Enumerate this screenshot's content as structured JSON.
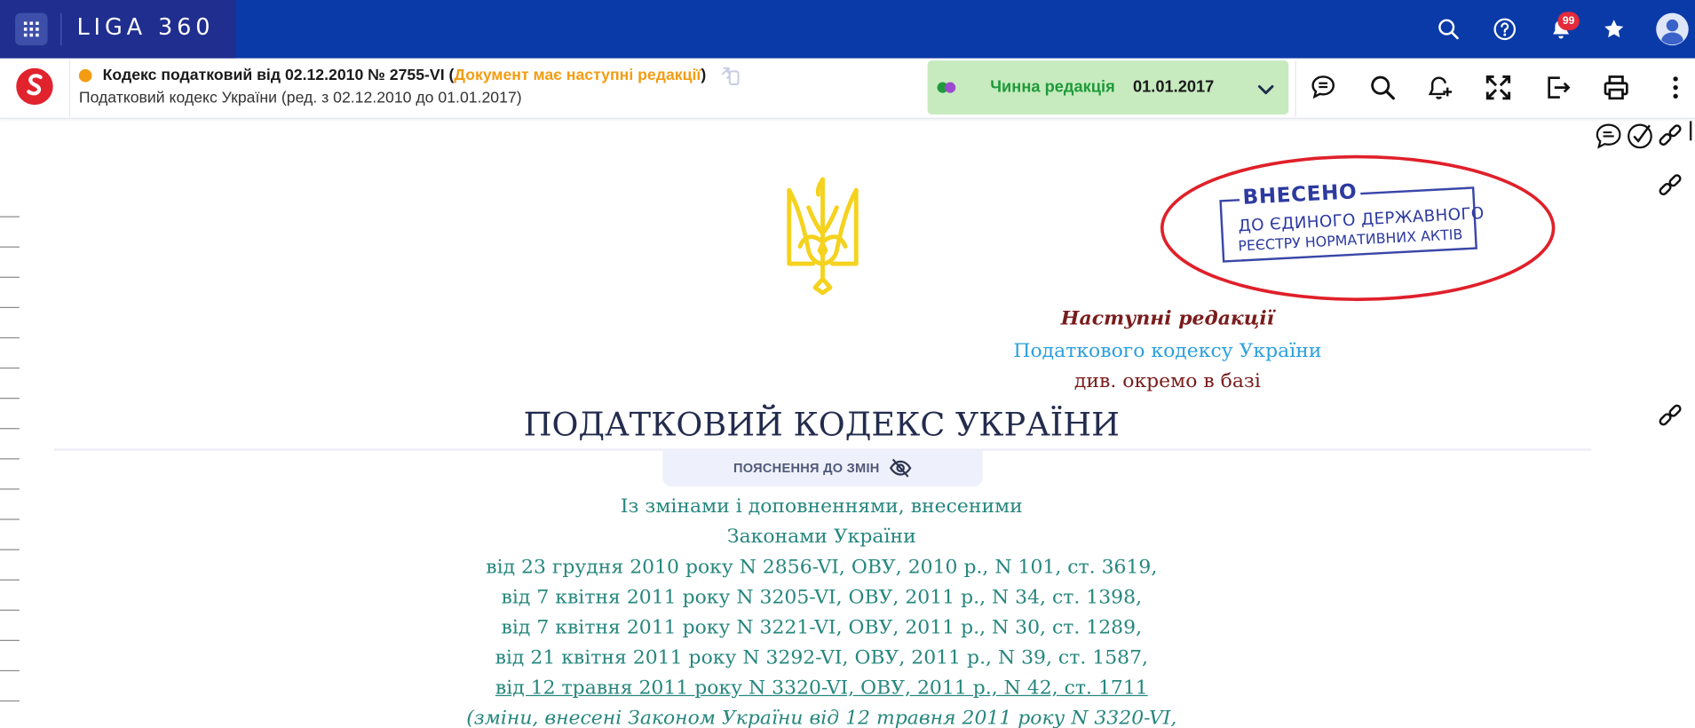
{
  "app": {
    "brand": "LIGA 360",
    "notifications_count": "99"
  },
  "topbar_icons": [
    "grid-apps-icon",
    "search-icon",
    "help-icon",
    "bell-icon",
    "star-icon",
    "user-avatar-icon"
  ],
  "document": {
    "title_prefix": "Кодекс податковий від 02.12.2010 № 2755-VI (",
    "title_warning": "Документ має наступні редакції",
    "title_suffix": ")",
    "subtitle": "Податковий кодекс України (ред. з 02.12.2010 до 01.01.2017)",
    "status_color": "#f39c12"
  },
  "edition": {
    "label": "Чинна редакція",
    "date": "01.01.2017"
  },
  "toolbar_icons": [
    "comments-icon",
    "search-in-doc-icon",
    "add-to-control-icon",
    "fullscreen-icon",
    "export-icon",
    "print-icon",
    "more-icon"
  ],
  "stamp": {
    "title": "ВНЕСЕНО",
    "line1": "ДО ЄДИНОГО ДЕРЖАВНОГО",
    "line2": "РЕЄСТРУ НОРМАТИВНИХ АКТІВ"
  },
  "next_editions": {
    "line1": "Наступні редакції",
    "line2": "Податкового кодексу України",
    "line3": "див. окремо в базі"
  },
  "main_title": "ПОДАТКОВИЙ КОДЕКС УКРАЇНИ",
  "explanation_button": "ПОЯСНЕННЯ ДО ЗМІН",
  "amendments": [
    "Із змінами і доповненнями, внесеними",
    "Законами  України",
    "від 23 грудня 2010 року N 2856-VI, ОВУ, 2010 р., N 101, ст. 3619,",
    "від 7 квітня 2011 року N 3205-VI, ОВУ, 2011 р., N 34, ст. 1398,",
    "від 7 квітня 2011 року N 3221-VI, ОВУ, 2011 р., N 30, ст. 1289,",
    "від 21 квітня 2011 року N 3292-VI, ОВУ, 2011 р., N 39, ст. 1587,",
    " від 12 травня 2011 року N 3320-VI, ОВУ, 2011 р., N 42, ст. 1711",
    "(зміни, внесені Законом України від 12 травня 2011 року N 3320-VI,"
  ],
  "colors": {
    "topbar": "#0a3aa8",
    "brand_block": "#1f2e8f",
    "edition_bg": "#c7ebbf",
    "edition_label": "#1f9a3a",
    "amendment_text": "#26877e",
    "next_edition_dark": "#7a1c1c",
    "next_edition_link": "#2b9fe0",
    "stamp_ellipse": "#e0202a",
    "stamp_ink": "#2d3aa0",
    "trident": "#f5d21e"
  }
}
